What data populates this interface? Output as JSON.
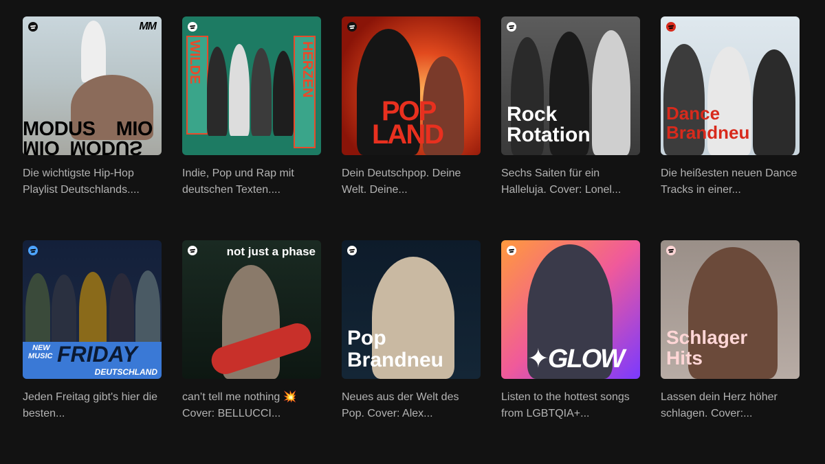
{
  "playlists": [
    {
      "title_lines": [
        "MODUS",
        "MIO"
      ],
      "description": "Die wichtigste Hip-Hop Playlist Deutschlands....",
      "logo_text": "MM"
    },
    {
      "title_lines": [
        "WILDE",
        "HERZEN"
      ],
      "description": "Indie, Pop und Rap mit deutschen Texten...."
    },
    {
      "title_lines": [
        "POP",
        "LAND"
      ],
      "description": "Dein Deutschpop. Deine Welt. Deine..."
    },
    {
      "title_lines": [
        "Rock",
        "Rotation"
      ],
      "description": "Sechs Saiten für ein Halleluja. Cover: Lonel..."
    },
    {
      "title_lines": [
        "Dance",
        "Brandneu"
      ],
      "description": "Die heißesten neuen Dance Tracks in einer..."
    },
    {
      "title_lines": [
        "NEW",
        "MUSIC",
        "FRIDAY",
        "DEUTSCHLAND"
      ],
      "description": "Jeden Freitag gibt's hier die besten..."
    },
    {
      "title_lines": [
        "not just a phase"
      ],
      "description": "can’t tell me nothing 💥 Cover: BELLUCCI..."
    },
    {
      "title_lines": [
        "Pop",
        "Brandneu"
      ],
      "description": "Neues aus der Welt des Pop. Cover: Alex..."
    },
    {
      "title_lines": [
        "GLOW"
      ],
      "description": "Listen to the hottest songs from LGBTQIA+..."
    },
    {
      "title_lines": [
        "Schlager",
        "Hits"
      ],
      "description": "Lassen dein Herz höher schlagen. Cover:..."
    }
  ],
  "icons": {
    "brand": "spotify-logo-icon"
  }
}
